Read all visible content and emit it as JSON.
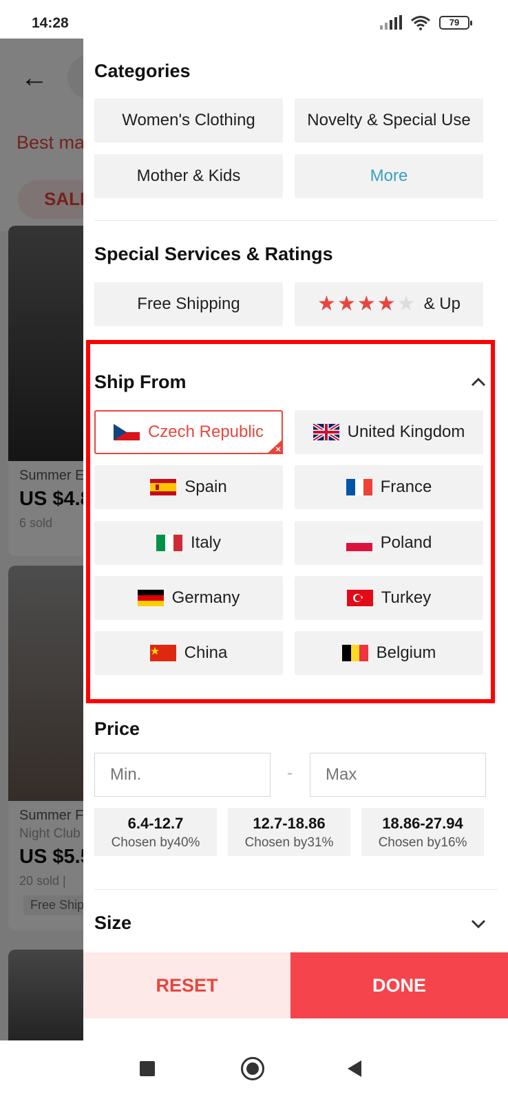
{
  "status_bar": {
    "time": "14:28",
    "battery": "79"
  },
  "background": {
    "sort_label": "Best ma",
    "sale_label": "SALE",
    "products": [
      {
        "title": "Summer E",
        "price": "US $4.8",
        "sold": "6 sold"
      },
      {
        "title": "Summer F",
        "subtitle": "Night Club",
        "price": "US $5.5",
        "sold": "20 sold |",
        "tag": "Free Shipp"
      }
    ]
  },
  "categories": {
    "title": "Categories",
    "items": [
      "Women's Clothing",
      "Novelty & Special Use",
      "Mother & Kids",
      "More"
    ]
  },
  "special": {
    "title": "Special Services & Ratings",
    "free_shipping": "Free Shipping",
    "rating_stars": 4,
    "rating_suffix": "& Up"
  },
  "ship_from": {
    "title": "Ship From",
    "expand_icon": "chevron-up-icon",
    "countries": [
      {
        "name": "Czech Republic",
        "flag": "flag-czech-icon",
        "selected": true
      },
      {
        "name": "United Kingdom",
        "flag": "flag-uk-icon",
        "selected": false
      },
      {
        "name": "Spain",
        "flag": "flag-spain-icon",
        "selected": false
      },
      {
        "name": "France",
        "flag": "flag-france-icon",
        "selected": false
      },
      {
        "name": "Italy",
        "flag": "flag-italy-icon",
        "selected": false
      },
      {
        "name": "Poland",
        "flag": "flag-poland-icon",
        "selected": false
      },
      {
        "name": "Germany",
        "flag": "flag-germany-icon",
        "selected": false
      },
      {
        "name": "Turkey",
        "flag": "flag-turkey-icon",
        "selected": false
      },
      {
        "name": "China",
        "flag": "flag-china-icon",
        "selected": false
      },
      {
        "name": "Belgium",
        "flag": "flag-belgium-icon",
        "selected": false
      }
    ],
    "selected_mark": "×"
  },
  "price": {
    "title": "Price",
    "min_placeholder": "Min.",
    "max_placeholder": "Max",
    "separator": "-",
    "ranges": [
      {
        "range": "6.4-12.7",
        "chosen": "Chosen by40%"
      },
      {
        "range": "12.7-18.86",
        "chosen": "Chosen by31%"
      },
      {
        "range": "18.86-27.94",
        "chosen": "Chosen by16%"
      }
    ]
  },
  "size": {
    "title": "Size",
    "expand_icon": "chevron-down-icon"
  },
  "actions": {
    "reset": "RESET",
    "done": "DONE"
  },
  "colors": {
    "accent": "#e8453c",
    "done_bg": "#f5444b",
    "more_link": "#3a9fc2",
    "highlight_box": "#ff0000"
  }
}
